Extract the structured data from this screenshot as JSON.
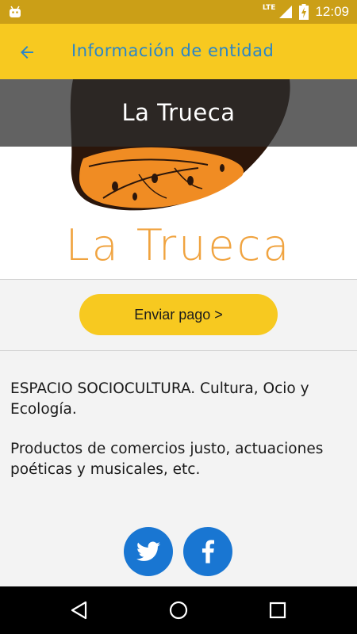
{
  "status_bar": {
    "time": "12:09",
    "network": "LTE",
    "icons": [
      "android-icon",
      "signal-icon",
      "battery-charging-icon"
    ]
  },
  "app_bar": {
    "title": "Información de entidad",
    "back_icon": "arrow-back-icon",
    "background": "#f7c920",
    "title_color": "#2a86c8"
  },
  "entity": {
    "name": "La Trueca",
    "logo_text": "La Trueca"
  },
  "actions": {
    "pay_label": "Enviar pago >"
  },
  "description": {
    "paragraph1": "ESPACIO SOCIOCULTURA. Cultura, Ocio y Ecología.",
    "paragraph2": "Productos de comercios justo, actuaciones poéticas y musicales, etc."
  },
  "social": {
    "twitter_icon": "twitter-icon",
    "facebook_icon": "facebook-icon",
    "button_color": "#1976d2"
  },
  "nav_bar": {
    "icons": [
      "back-triangle-icon",
      "home-circle-icon",
      "recents-square-icon"
    ]
  }
}
